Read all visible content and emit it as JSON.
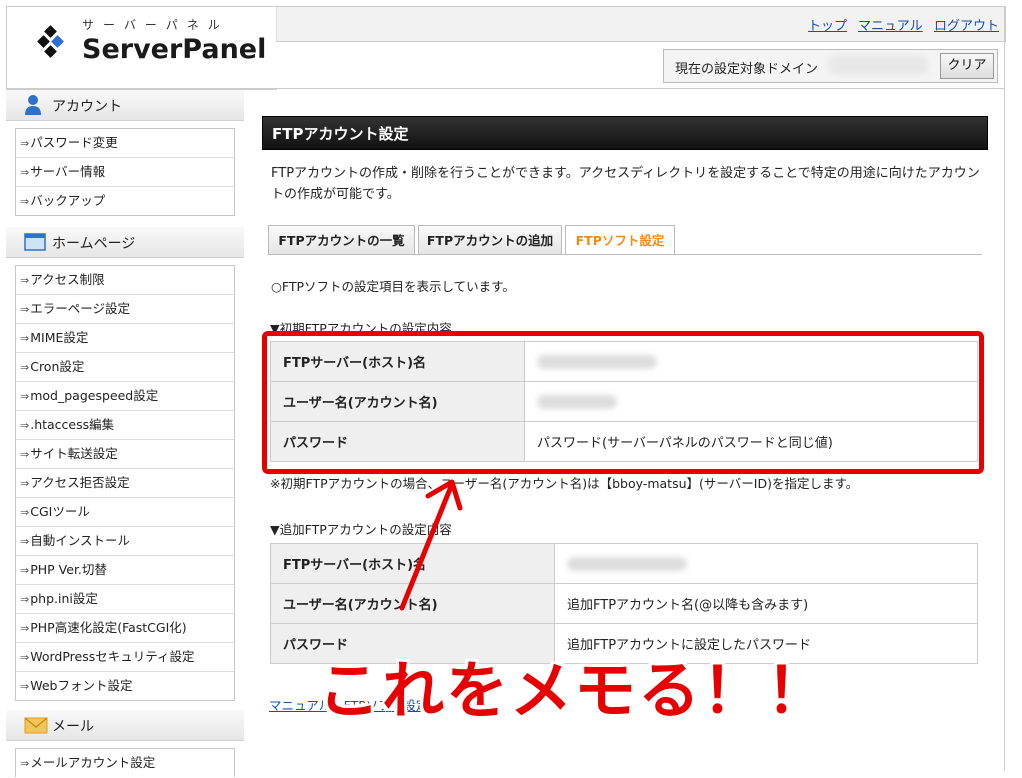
{
  "header": {
    "logo_kana": "サーバーパネル",
    "logo_text": "ServerPanel",
    "links": [
      "トップ",
      "マニュアル",
      "ログアウト"
    ],
    "domain_label": "現在の設定対象ドメイン",
    "clear_button": "クリア"
  },
  "sidebar": {
    "sections": [
      {
        "title": "アカウント",
        "icon": "user-icon",
        "items": [
          "パスワード変更",
          "サーバー情報",
          "バックアップ"
        ]
      },
      {
        "title": "ホームページ",
        "icon": "window-icon",
        "items": [
          "アクセス制限",
          "エラーページ設定",
          "MIME設定",
          "Cron設定",
          "mod_pagespeed設定",
          ".htaccess編集",
          "サイト転送設定",
          "アクセス拒否設定",
          "CGIツール",
          "自動インストール",
          "PHP Ver.切替",
          "php.ini設定",
          "PHP高速化設定(FastCGI化)",
          "WordPressセキュリティ設定",
          "Webフォント設定"
        ]
      },
      {
        "title": "メール",
        "icon": "mail-icon",
        "items": [
          "メールアカウント設定"
        ]
      }
    ]
  },
  "main": {
    "title": "FTPアカウント設定",
    "description": "FTPアカウントの作成・削除を行うことができます。アクセスディレクトリを設定することで特定の用途に向けたアカウントの作成が可能です。",
    "tabs": [
      {
        "label": "FTPアカウントの一覧",
        "active": false
      },
      {
        "label": "FTPアカウントの追加",
        "active": false
      },
      {
        "label": "FTPソフト設定",
        "active": true
      }
    ],
    "info": "○FTPソフトの設定項目を表示しています。",
    "initial_section": {
      "title": "▼初期FTPアカウントの設定内容",
      "rows": [
        {
          "key": "FTPサーバー(ホスト)名",
          "value": ""
        },
        {
          "key": "ユーザー名(アカウント名)",
          "value": ""
        },
        {
          "key": "パスワード",
          "value": "パスワード(サーバーパネルのパスワードと同じ値)"
        }
      ]
    },
    "note": "※初期FTPアカウントの場合、ユーザー名(アカウント名)は【bboy-matsu】(サーバーID)を指定します。",
    "additional_section": {
      "title": "▼追加FTPアカウントの設定内容",
      "rows": [
        {
          "key": "FTPサーバー(ホスト)名",
          "value": ""
        },
        {
          "key": "ユーザー名(アカウント名)",
          "value": "追加FTPアカウント名(@以降も含みます)"
        },
        {
          "key": "パスワード",
          "value": "追加FTPアカウントに設定したパスワード"
        }
      ]
    },
    "manual_link": "マニュアル：FTPソフト設定"
  },
  "annotation": {
    "text": "これをメモる！！",
    "color": "#e60000"
  }
}
